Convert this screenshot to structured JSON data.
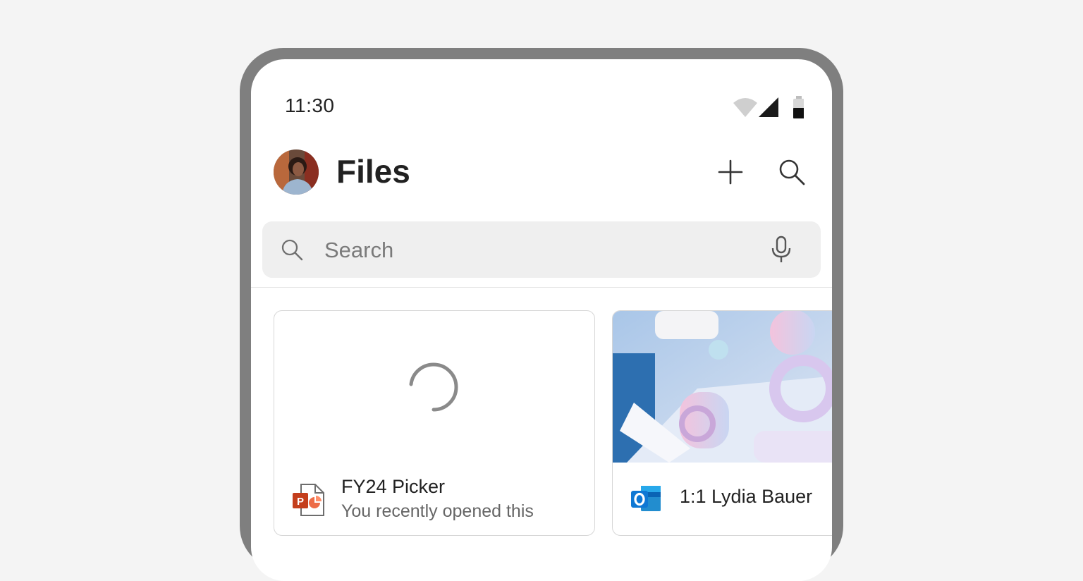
{
  "status_bar": {
    "time": "11:30",
    "icons": [
      "wifi-icon",
      "cellular-signal-icon",
      "battery-icon"
    ]
  },
  "header": {
    "title": "Files",
    "avatar": "user-avatar",
    "actions": [
      "add-icon",
      "search-icon"
    ]
  },
  "search": {
    "placeholder": "Search",
    "value": "",
    "icons": [
      "search-icon",
      "microphone-icon"
    ]
  },
  "files": [
    {
      "name": "FY24 Picker",
      "subtitle": "You recently opened this",
      "app_icon": "powerpoint-icon",
      "preview": "loading-spinner"
    },
    {
      "name": "1:1 Lydia Bauer",
      "app_icon": "outlook-icon",
      "preview": "image-thumbnail"
    }
  ],
  "colors": {
    "background": "#f4f4f4",
    "frame": "#7f7f7f",
    "search_bar": "#efefef",
    "powerpoint": "#c43e1c",
    "outlook": "#0078d4"
  }
}
